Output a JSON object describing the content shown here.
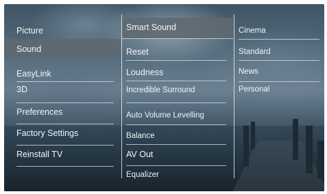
{
  "menu": {
    "col1": [
      {
        "label": "Picture"
      },
      {
        "label": "Sound"
      },
      {
        "label": "EasyLink"
      },
      {
        "label": "3D"
      },
      {
        "label": "Preferences"
      },
      {
        "label": "Factory Settings"
      },
      {
        "label": "Reinstall TV"
      }
    ],
    "col2": [
      {
        "label": "Smart Sound"
      },
      {
        "label": "Reset"
      },
      {
        "label": "Loudness"
      },
      {
        "label": "Incredible Surround"
      },
      {
        "label": "Auto Volume Levelling"
      },
      {
        "label": "Balance"
      },
      {
        "label": "AV Out"
      },
      {
        "label": "Equalizer"
      }
    ],
    "col3": [
      {
        "label": "Cinema"
      },
      {
        "label": "Standard"
      },
      {
        "label": "News"
      },
      {
        "label": "Personal"
      }
    ]
  }
}
